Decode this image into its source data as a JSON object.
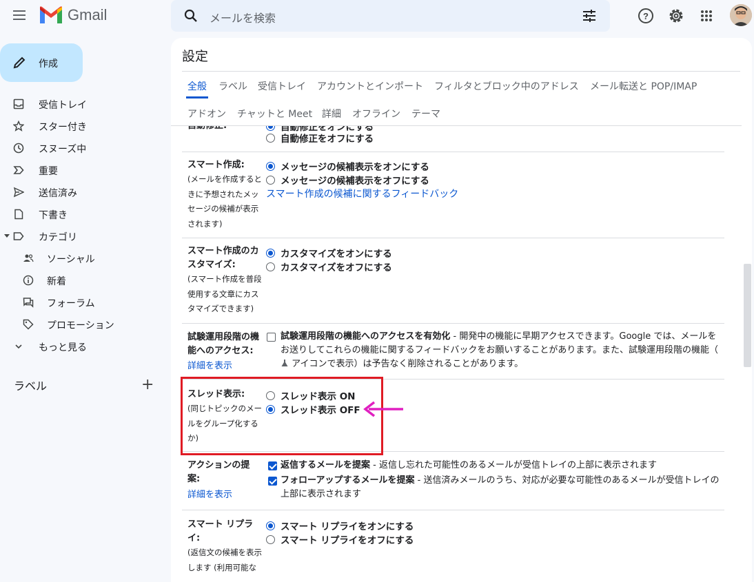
{
  "header": {
    "brand": "Gmail",
    "search_placeholder": "メールを検索",
    "icons": [
      "menu-icon",
      "gmail-logo",
      "search-icon",
      "tune-icon",
      "help-icon",
      "gear-icon",
      "apps-icon",
      "avatar"
    ]
  },
  "sidebar": {
    "compose_label": "作成",
    "items": [
      {
        "label": "受信トレイ",
        "icon": "inbox-icon"
      },
      {
        "label": "スター付き",
        "icon": "star-icon"
      },
      {
        "label": "スヌーズ中",
        "icon": "clock-icon"
      },
      {
        "label": "重要",
        "icon": "important-icon"
      },
      {
        "label": "送信済み",
        "icon": "send-icon"
      },
      {
        "label": "下書き",
        "icon": "draft-icon"
      },
      {
        "label": "カテゴリ",
        "icon": "label-icon"
      },
      {
        "label": "ソーシャル",
        "icon": "people-icon"
      },
      {
        "label": "新着",
        "icon": "info-icon"
      },
      {
        "label": "フォーラム",
        "icon": "forum-icon"
      },
      {
        "label": "プロモーション",
        "icon": "tag-icon"
      },
      {
        "label": "もっと見る",
        "icon": "chevron-down-icon"
      }
    ],
    "labels_heading": "ラベル",
    "labels_add": "+"
  },
  "settings": {
    "title": "設定",
    "tabs_row1": [
      "全般",
      "ラベル",
      "受信トレイ",
      "アカウントとインポート",
      "フィルタとブロック中のアドレス",
      "メール転送と POP/IMAP"
    ],
    "tabs_row2": [
      "アドオン",
      "チャットと Meet",
      "詳細",
      "オフライン",
      "テーマ"
    ],
    "autocorrect": {
      "label_partial": "自動修正:",
      "option_on_partial": "自動修正をオンにする",
      "option_off": "自動修正をオフにする"
    },
    "smart_compose": {
      "label": "スマート作成:",
      "desc": "(メールを作成するときに予想されたメッセージの候補が表示されます)",
      "option_on": "メッセージの候補表示をオンにする",
      "option_off": "メッセージの候補表示をオフにする",
      "link": "スマート作成の候補に関するフィードバック"
    },
    "smart_compose_custom": {
      "label": "スマート作成のカスタマイズ:",
      "desc": "(スマート作成を普段使用する文章にカスタマイズできます)",
      "option_on": "カスタマイズをオンにする",
      "option_off": "カスタマイズをオフにする"
    },
    "experimental": {
      "label": "試験運用段階の機能へのアクセス:",
      "link": "詳細を表示",
      "checkbox_label": "試験運用段階の機能へのアクセスを有効化",
      "desc": " - 開発中の機能に早期アクセスできます。Google では、メールをお送りしてこれらの機能に関するフィードバックをお願いすることがあります。また、試験運用段階の機能（",
      "desc_tail": " アイコンで表示）は予告なく削除されることがあります。"
    },
    "threading": {
      "label": "スレッド表示:",
      "desc": "(同じトピックのメールをグループ化するか)",
      "option_on": "スレッド表示 ON",
      "option_off": "スレッド表示 OFF"
    },
    "nudges": {
      "label": "アクションの提案:",
      "link": "詳細を表示",
      "opt1_bold": "返信するメールを提案",
      "opt1_desc": " - 返信し忘れた可能性のあるメールが受信トレイの上部に表示されます",
      "opt2_bold": "フォローアップするメールを提案",
      "opt2_desc": " - 送信済みメールのうち、対応が必要な可能性のあるメールが受信トレイの上部に表示されます"
    },
    "smart_reply": {
      "label": "スマート リプライ:",
      "desc": "(返信文の候補を表示します (利用可能な",
      "option_on": "スマート リプライをオンにする",
      "option_off": "スマート リプライをオフにする"
    }
  },
  "colors": {
    "accent": "#0b57d0",
    "annotation_box": "#e01b24",
    "annotation_arrow": "#e020c0"
  }
}
